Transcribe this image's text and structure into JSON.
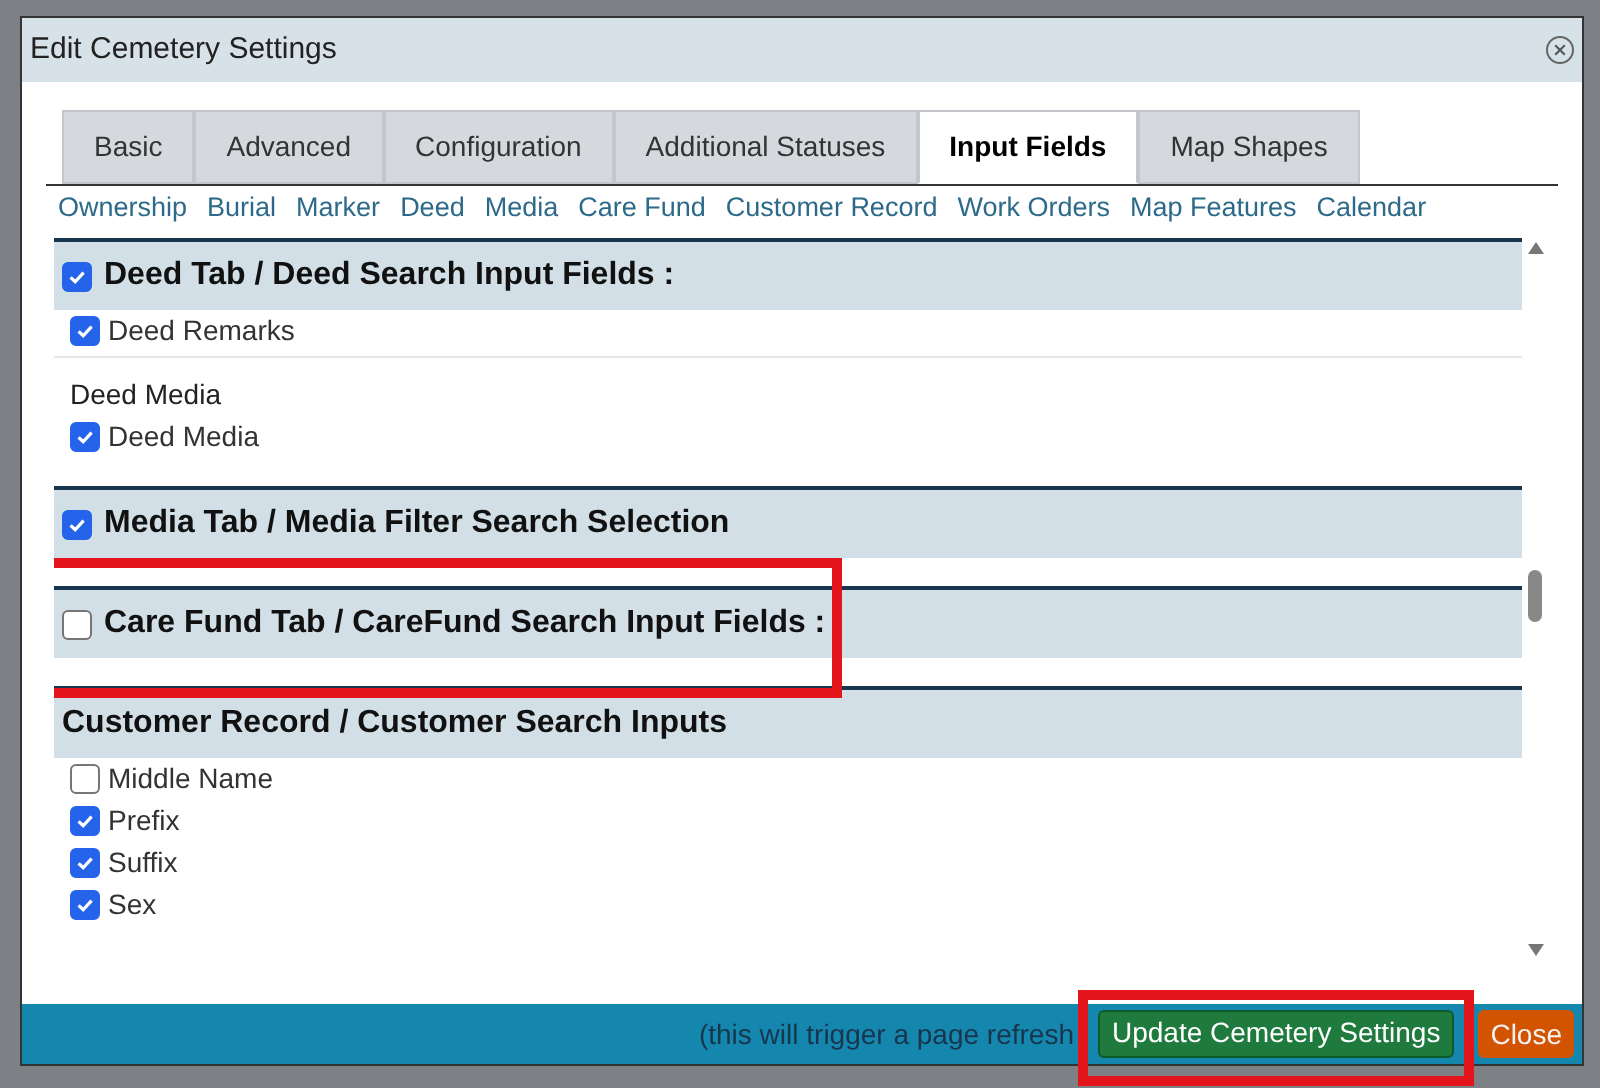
{
  "window": {
    "title": "Edit Cemetery Settings"
  },
  "tabs": [
    {
      "label": "Basic",
      "selected": false
    },
    {
      "label": "Advanced",
      "selected": false
    },
    {
      "label": "Configuration",
      "selected": false
    },
    {
      "label": "Additional Statuses",
      "selected": false
    },
    {
      "label": "Input Fields",
      "selected": true
    },
    {
      "label": "Map Shapes",
      "selected": false
    }
  ],
  "sub_links": [
    "Ownership",
    "Burial",
    "Marker",
    "Deed",
    "Media",
    "Care Fund",
    "Customer Record",
    "Work Orders",
    "Map Features",
    "Calendar"
  ],
  "sections": [
    {
      "kind": "checkbox",
      "title": "Deed Tab / Deed Search Input Fields :",
      "checked": true,
      "groups": [
        {
          "items": [
            {
              "label": "Deed Remarks",
              "checked": true
            }
          ]
        },
        {
          "heading": "Deed Media",
          "items": [
            {
              "label": "Deed Media",
              "checked": true
            }
          ]
        }
      ]
    },
    {
      "kind": "checkbox",
      "title": "Media Tab / Media Filter Search Selection",
      "checked": true
    },
    {
      "kind": "checkbox",
      "title": "Care Fund Tab / CareFund Search Input Fields :",
      "checked": false,
      "highlighted": true
    },
    {
      "kind": "plain",
      "title": "Customer Record / Customer Search Inputs",
      "groups": [
        {
          "items": [
            {
              "label": "Middle Name",
              "checked": false
            },
            {
              "label": "Prefix",
              "checked": true
            },
            {
              "label": "Suffix",
              "checked": true
            },
            {
              "label": "Sex",
              "checked": true
            }
          ]
        }
      ]
    }
  ],
  "footer": {
    "note": "(this will trigger a page refresh",
    "buttons": [
      {
        "kind": "primary",
        "label": "Update Cemetery Settings",
        "highlighted": true
      },
      {
        "kind": "danger",
        "label": "Close"
      }
    ]
  }
}
